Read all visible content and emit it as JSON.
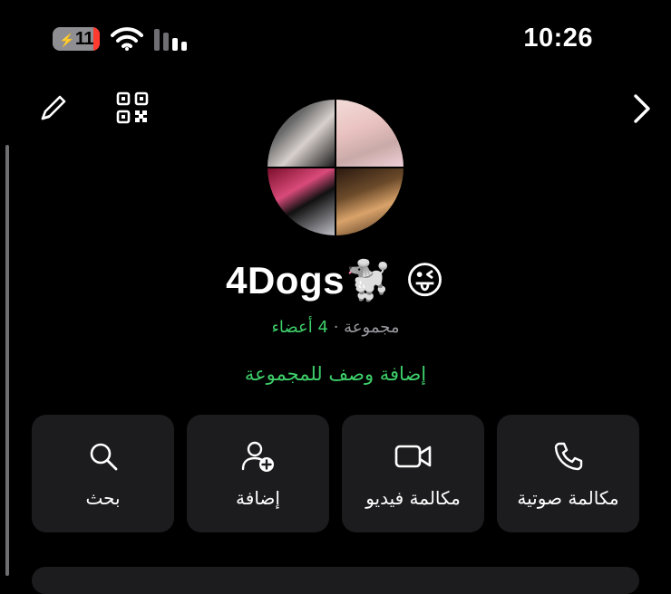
{
  "status_bar": {
    "battery_level": "11",
    "time": "10:26",
    "icons": [
      "charging-bolt-icon",
      "wifi-icon",
      "cellular-signal-icon"
    ],
    "colors": {
      "battery_low": "#ff3b30"
    }
  },
  "top_bar": {
    "icons": [
      "pencil-edit-icon",
      "qr-code-icon",
      "chevron-right-icon"
    ]
  },
  "group": {
    "name": "4Dogs",
    "name_emojis": "🐩 😜",
    "type_label": "مجموعة",
    "separator": "·",
    "members_label": "4 أعضاء",
    "add_description": "إضافة وصف للمجموعة"
  },
  "actions": [
    {
      "id": "voice-call",
      "label": "مكالمة صوتية",
      "icon": "phone-icon"
    },
    {
      "id": "video-call",
      "label": "مكالمة فيديو",
      "icon": "video-camera-icon"
    },
    {
      "id": "add",
      "label": "إضافة",
      "icon": "add-person-icon"
    },
    {
      "id": "search",
      "label": "بحث",
      "icon": "search-icon"
    }
  ],
  "theme": {
    "background": "#000000",
    "card": "#1c1c1e",
    "accent_green": "#3ecf6a",
    "secondary_text": "#98989f"
  }
}
